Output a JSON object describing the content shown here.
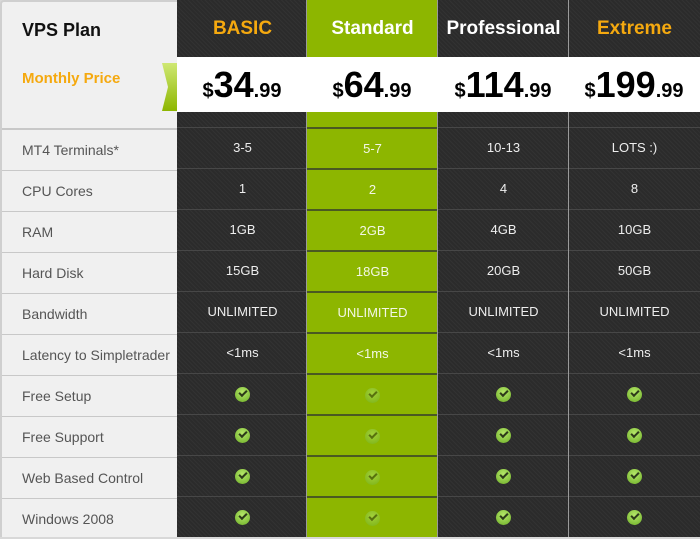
{
  "table": {
    "title": "VPS Plan",
    "price_label": "Monthly Price",
    "features": [
      "MT4 Terminals*",
      "CPU Cores",
      "RAM",
      "Hard Disk",
      "Bandwidth",
      "Latency to Simpletrader",
      "Free Setup",
      "Free Support",
      "Web Based Control",
      "Windows 2008"
    ],
    "plans": [
      {
        "name": "BASIC",
        "name_color": "#f5a90f",
        "theme": "dark",
        "price": {
          "currency": "$",
          "int": "34",
          "dec": ".99"
        },
        "values": [
          "3-5",
          "1",
          "1GB",
          "15GB",
          "UNLIMITED",
          "<1ms",
          "check-icon",
          "check-icon",
          "check-icon",
          "check-icon"
        ]
      },
      {
        "name": "Standard",
        "name_color": "#ffffff",
        "theme": "green",
        "price": {
          "currency": "$",
          "int": "64",
          "dec": ".99"
        },
        "values": [
          "5-7",
          "2",
          "2GB",
          "18GB",
          "UNLIMITED",
          "<1ms",
          "check-icon",
          "check-icon",
          "check-icon",
          "check-icon"
        ]
      },
      {
        "name": "Professional",
        "name_color": "#ffffff",
        "theme": "dark",
        "price": {
          "currency": "$",
          "int": "114",
          "dec": ".99"
        },
        "values": [
          "10-13",
          "4",
          "4GB",
          "20GB",
          "UNLIMITED",
          "<1ms",
          "check-icon",
          "check-icon",
          "check-icon",
          "check-icon"
        ]
      },
      {
        "name": "Extreme",
        "name_color": "#f5a90f",
        "theme": "dark",
        "price": {
          "currency": "$",
          "int": "199",
          "dec": ".99"
        },
        "values": [
          "LOTS :)",
          "8",
          "10GB",
          "50GB",
          "UNLIMITED",
          "<1ms",
          "check-icon",
          "check-icon",
          "check-icon",
          "check-icon"
        ]
      }
    ],
    "colors": {
      "accent_orange": "#f5a90f",
      "accent_green": "#8db600",
      "dark": "#2b2b2b"
    }
  }
}
